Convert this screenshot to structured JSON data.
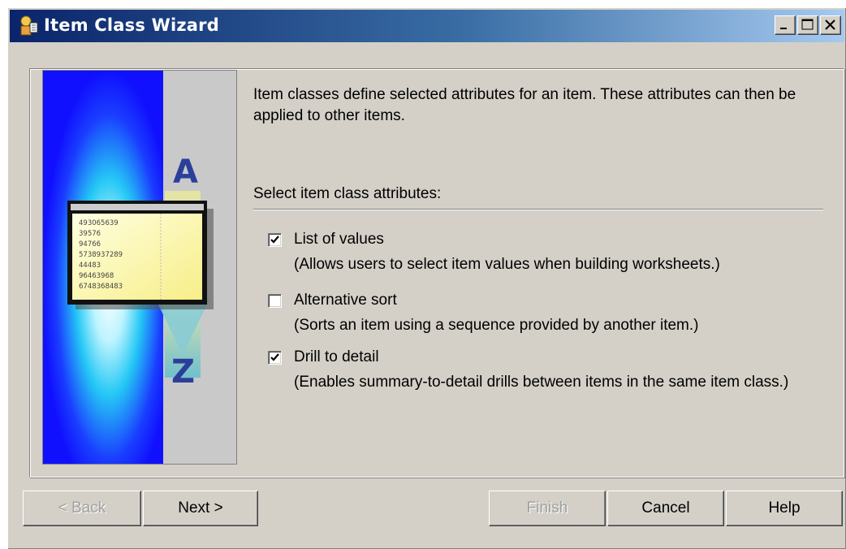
{
  "window": {
    "title": "Item Class Wizard"
  },
  "intro_text": "Item classes define selected attributes for an item.  These attributes can then be applied to other items.",
  "section_label": "Select item class attributes:",
  "options": [
    {
      "label": "List of values",
      "description": "(Allows users to select item values when building worksheets.)",
      "checked": true
    },
    {
      "label": "Alternative sort",
      "description": "(Sorts an item using a sequence provided by another item.)",
      "checked": false
    },
    {
      "label": "Drill to detail",
      "description": "(Enables summary-to-detail drills between items in the same item class.)",
      "checked": true
    }
  ],
  "illustration": {
    "letter_top": "A",
    "letter_bottom": "Z",
    "numbers": [
      "493065639",
      "39576",
      "94766",
      "5738937289",
      "44483",
      "96463968",
      "6748368483"
    ]
  },
  "buttons": {
    "back": "< Back",
    "next": "Next >",
    "finish": "Finish",
    "cancel": "Cancel",
    "help": "Help"
  },
  "colors": {
    "titlebar_start": "#0a246a",
    "titlebar_end": "#a6caf0",
    "dialog_bg": "#d4d0c8"
  }
}
